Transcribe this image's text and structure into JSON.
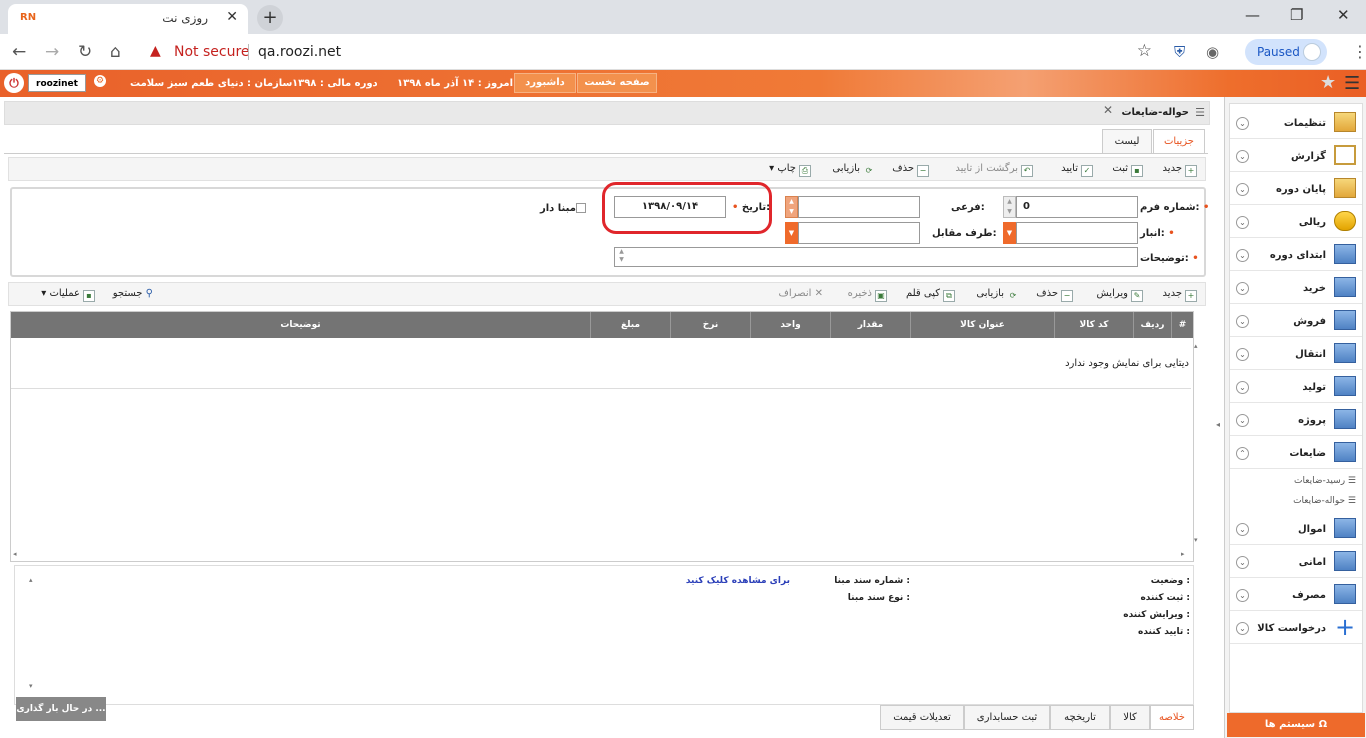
{
  "browser": {
    "tab_title": "روزی نت",
    "favicon_text": "RN",
    "not_secure": "Not secure",
    "url": "qa.roozi.net",
    "profile_status": "Paused"
  },
  "header": {
    "username": "roozinet",
    "home_button": "صفحه نخست",
    "dashboard_button": "داشبورد",
    "today": "امروز : ۱۴ آذر ماه ۱۳۹۸",
    "fiscal_period": "دوره مالی : ۱۳۹۸",
    "organization": "سازمان : دنیای طعم سبز سلامت"
  },
  "sidebar": {
    "items": [
      {
        "label": "تنظیمات"
      },
      {
        "label": "گزارش"
      },
      {
        "label": "پایان دوره"
      },
      {
        "label": "ریالی"
      },
      {
        "label": "ابتدای دوره"
      },
      {
        "label": "خرید"
      },
      {
        "label": "فروش"
      },
      {
        "label": "انتقال"
      },
      {
        "label": "تولید"
      },
      {
        "label": "پروژه"
      },
      {
        "label": "ضایعات"
      },
      {
        "label": "اموال"
      },
      {
        "label": "امانی"
      },
      {
        "label": "مصرف"
      },
      {
        "label": "درخواست کالا"
      }
    ],
    "subitems": [
      "رسید-ضایعات",
      "حواله-ضایعات"
    ],
    "footer": "سیستم ها Ω"
  },
  "page": {
    "title": "حواله-ضایعات",
    "tabs": [
      "جزییات",
      "لیست"
    ]
  },
  "toolbar": {
    "new": "جدید",
    "save": "ثبت",
    "approve": "تایید",
    "unapprove": "برگشت از تایید",
    "delete": "حذف",
    "refresh": "بازیابی",
    "print": "چاپ"
  },
  "form": {
    "form_number_label": "شماره فرم:",
    "form_number_value": "0",
    "sub_label": "فرعی:",
    "date_label": "تاریخ:",
    "date_value": "۱۳۹۸/۰۹/۱۴",
    "based_label": "مبنا دار",
    "warehouse_label": "انبار:",
    "counterparty_label": "طرف مقابل:",
    "description_label": "توضیحات:"
  },
  "grid_toolbar": {
    "new": "جدید",
    "edit": "ویرایش",
    "delete": "حذف",
    "refresh": "بازیابی",
    "copy_item": "کپی قلم",
    "store": "ذخیره",
    "cancel": "انصراف",
    "search": "جستجو",
    "operations": "عملیات"
  },
  "grid": {
    "columns": [
      "#",
      "ردیف",
      "کد کالا",
      "عنوان کالا",
      "مقدار",
      "واحد",
      "نرخ",
      "مبلغ",
      "توضیحات"
    ],
    "empty_message": "دیتایی برای نمایش وجود ندارد"
  },
  "info": {
    "status_label": "وضعیت :",
    "registrar_label": "ثبت کننده :",
    "editor_label": "ویرایش کننده :",
    "approver_label": "تایید کننده :",
    "base_doc_number_label": "شماره سند مبنا :",
    "base_doc_type_label": "نوع سند مبنا :",
    "view_link": "برای مشاهده کلیک کنید"
  },
  "loading_text": "در حال بار گذاری ...",
  "bottom_tabs": [
    "خلاصه",
    "کالا",
    "تاریخچه",
    "ثبت حسابداری",
    "تعدیلات قیمت"
  ]
}
